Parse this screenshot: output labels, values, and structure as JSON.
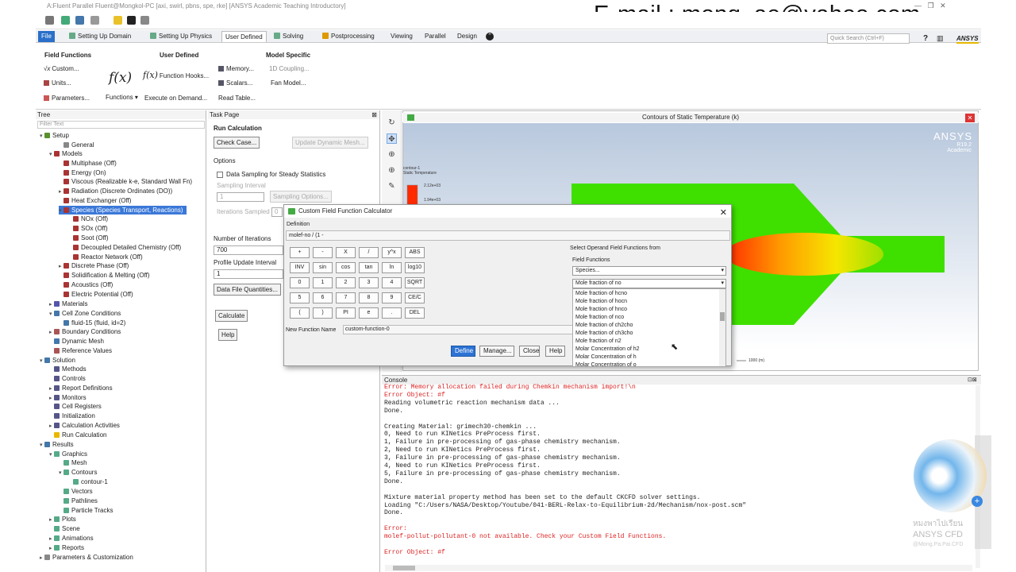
{
  "window": {
    "title": "A:Fluent Parallel Fluent@Mongkol-PC  [axi, swirl, pbns, spe, rke] [ANSYS Academic Teaching Introductory]"
  },
  "overlay": {
    "email": "E-mail : mong_ae@yahoo.com",
    "watermark_line1": "หมงพาไปเรียน",
    "watermark_line2": "ANSYS CFD",
    "watermark_line3": "@Mong.Pa.Pai.CFD"
  },
  "menu": {
    "file": "File",
    "tabs": [
      "Setting Up Domain",
      "Setting Up Physics",
      "User Defined",
      "Solving",
      "Postprocessing",
      "Viewing",
      "Parallel",
      "Design"
    ],
    "quick_search_placeholder": "Quick Search (Ctrl+F)",
    "brand": "ANSYS"
  },
  "ribbon": {
    "field_functions": {
      "title": "Field Functions",
      "custom": "Custom...",
      "units": "Units...",
      "parameters": "Parameters..."
    },
    "user_defined": {
      "title": "User Defined",
      "functions": "Functions",
      "function_hooks": "Function Hooks...",
      "execute_on_demand": "Execute on Demand...",
      "memory": "Memory...",
      "scalars": "Scalars...",
      "read_table": "Read Table..."
    },
    "model_specific": {
      "title": "Model Specific",
      "coupling": "1D Coupling...",
      "fan_model": "Fan Model..."
    }
  },
  "tree": {
    "header": "Tree",
    "filter_placeholder": "Filter Text",
    "nodes": [
      {
        "label": "Setup"
      },
      {
        "label": "General"
      },
      {
        "label": "Models"
      },
      {
        "label": "Multiphase (Off)"
      },
      {
        "label": "Energy (On)"
      },
      {
        "label": "Viscous (Realizable k-e, Standard Wall Fn)"
      },
      {
        "label": "Radiation (Discrete Ordinates (DO))"
      },
      {
        "label": "Heat Exchanger (Off)"
      },
      {
        "label": "Species (Species Transport, Reactions)"
      },
      {
        "label": "NOx (Off)"
      },
      {
        "label": "SOx (Off)"
      },
      {
        "label": "Soot (Off)"
      },
      {
        "label": "Decoupled Detailed Chemistry (Off)"
      },
      {
        "label": "Reactor Network (Off)"
      },
      {
        "label": "Discrete Phase (Off)"
      },
      {
        "label": "Solidification & Melting (Off)"
      },
      {
        "label": "Acoustics (Off)"
      },
      {
        "label": "Electric Potential (Off)"
      },
      {
        "label": "Materials"
      },
      {
        "label": "Cell Zone Conditions"
      },
      {
        "label": "fluid-15 (fluid, id=2)"
      },
      {
        "label": "Boundary Conditions"
      },
      {
        "label": "Dynamic Mesh"
      },
      {
        "label": "Reference Values"
      },
      {
        "label": "Solution"
      },
      {
        "label": "Methods"
      },
      {
        "label": "Controls"
      },
      {
        "label": "Report Definitions"
      },
      {
        "label": "Monitors"
      },
      {
        "label": "Cell Registers"
      },
      {
        "label": "Initialization"
      },
      {
        "label": "Calculation Activities"
      },
      {
        "label": "Run Calculation"
      },
      {
        "label": "Results"
      },
      {
        "label": "Graphics"
      },
      {
        "label": "Mesh"
      },
      {
        "label": "Contours"
      },
      {
        "label": "contour-1"
      },
      {
        "label": "Vectors"
      },
      {
        "label": "Pathlines"
      },
      {
        "label": "Particle Tracks"
      },
      {
        "label": "Plots"
      },
      {
        "label": "Scene"
      },
      {
        "label": "Animations"
      },
      {
        "label": "Reports"
      },
      {
        "label": "Parameters & Customization"
      }
    ]
  },
  "task": {
    "header": "Task Page",
    "title": "Run Calculation",
    "check_case": "Check Case...",
    "update_dynamic_mesh": "Update Dynamic Mesh...",
    "options": "Options",
    "data_sampling": "Data Sampling for Steady Statistics",
    "sampling_interval": "Sampling Interval",
    "sampling_interval_value": "1",
    "sampling_options": "Sampling Options...",
    "iterations_sampled": "Iterations Sampled",
    "iterations_sampled_value": "0",
    "number_of_iterations": "Number of Iterations",
    "iterations_value": "700",
    "profile_update_interval": "Profile Update Interval",
    "profile_value": "1",
    "data_file_quantities": "Data File Quantities...",
    "calculate": "Calculate",
    "help": "Help"
  },
  "graphics": {
    "title": "Contours of Static Temperature (k)",
    "logo": "ANSYS",
    "version": "R19.2",
    "edition": "Academic",
    "legend_title_1": "contour-1",
    "legend_title_2": "Static Temperature",
    "legend_v1": "2.12e+03",
    "legend_v2": "1.94e+03",
    "scale_label": "1000 (m)"
  },
  "dialog": {
    "title": "Custom Field Function Calculator",
    "definition_label": "Definition",
    "definition_value": "molef-no / (1 -",
    "keys": [
      [
        "+",
        "-",
        "X",
        "/",
        "y^x",
        "ABS"
      ],
      [
        "INV",
        "sin",
        "cos",
        "tan",
        "ln",
        "log10"
      ],
      [
        "0",
        "1",
        "2",
        "3",
        "4",
        "SQRT"
      ],
      [
        "5",
        "6",
        "7",
        "8",
        "9",
        "CE/C"
      ],
      [
        "(",
        ")",
        "PI",
        "e",
        ".",
        "DEL"
      ]
    ],
    "select_label": "Select Operand Field Functions from",
    "field_functions_label": "Field Functions",
    "category_value": "Species...",
    "function_value": "Mole fraction of no",
    "options": [
      "Mole fraction of hcno",
      "Mole fraction of hocn",
      "Mole fraction of hnco",
      "Mole fraction of nco",
      "Mole fraction of ch2cho",
      "Mole fraction of ch3cho",
      "Mole fraction of n2",
      "Molar Concentration of h2",
      "Molar Concentration of h",
      "Molar Concentration of o"
    ],
    "new_function_name_label": "New Function Name",
    "new_function_name_value": "custom-function-0",
    "define": "Define",
    "manage": "Manage...",
    "close": "Close",
    "help": "Help"
  },
  "console": {
    "header": "Console",
    "lines": [
      {
        "text": "Error: Memory allocation failed during Chemkin mechanism import!\\n",
        "type": "err"
      },
      {
        "text": "Error Object: #f",
        "type": "err"
      },
      {
        "text": "Reading volumetric reaction mechanism data ...",
        "type": "normal"
      },
      {
        "text": "Done.",
        "type": "normal"
      },
      {
        "text": "",
        "type": "normal"
      },
      {
        "text": "Creating Material: grimech30-chemkin ...",
        "type": "normal"
      },
      {
        "text": "0, Need to run KINetics PreProcess first.",
        "type": "normal"
      },
      {
        "text": "1, Failure in pre-processing of gas-phase chemistry mechanism.",
        "type": "normal"
      },
      {
        "text": "2, Need to run KINetics PreProcess first.",
        "type": "normal"
      },
      {
        "text": "3, Failure in pre-processing of gas-phase chemistry mechanism.",
        "type": "normal"
      },
      {
        "text": "4, Need to run KINetics PreProcess first.",
        "type": "normal"
      },
      {
        "text": "5, Failure in pre-processing of gas-phase chemistry mechanism.",
        "type": "normal"
      },
      {
        "text": "Done.",
        "type": "normal"
      },
      {
        "text": "",
        "type": "normal"
      },
      {
        "text": "Mixture material property method has been set to the default CKCFD solver settings.",
        "type": "normal"
      },
      {
        "text": "Loading \"C:/Users/NASA/Desktop/Youtube/041-BERL-Relax-to-Equilibrium-2d/Mechanism/nox-post.scm\"",
        "type": "normal"
      },
      {
        "text": "Done.",
        "type": "normal"
      },
      {
        "text": "",
        "type": "normal"
      },
      {
        "text": "Error:",
        "type": "err"
      },
      {
        "text": "molef-pollut-pollutant-0 not available. Check your Custom Field Functions.",
        "type": "err"
      },
      {
        "text": "",
        "type": "normal"
      },
      {
        "text": "Error Object: #f",
        "type": "err"
      }
    ]
  },
  "colors": {
    "accent": "#2a6fc9",
    "selection": "#3a78d8",
    "error": "#d22222",
    "contour_green": "#3fe000",
    "contour_hot": "#ff2a00"
  }
}
